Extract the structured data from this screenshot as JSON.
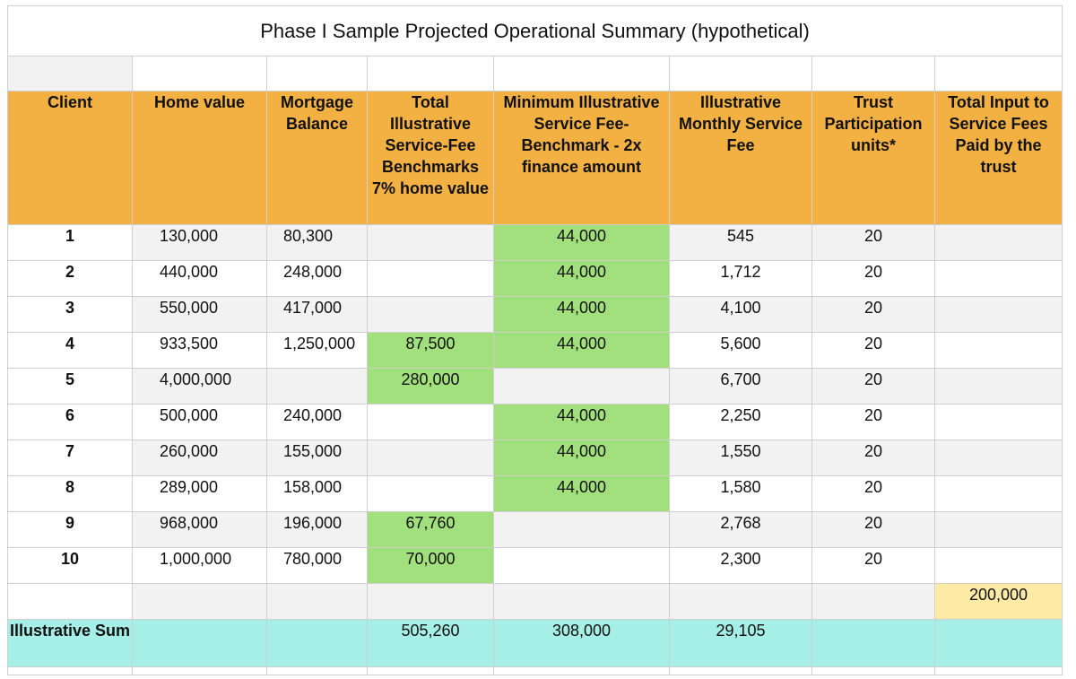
{
  "title": "Phase I Sample Projected Operational Summary (hypothetical)",
  "headers": [
    "Client",
    "Home value",
    "Mortgage Balance",
    "Total Illustrative Service-Fee Benchmarks 7% home value",
    "Minimum Illustrative Service Fee- Benchmark - 2x finance amount",
    "Illustrative Monthly Service Fee",
    "Trust Participation units*",
    "Total Input to Service Fees Paid by the trust"
  ],
  "rows": [
    {
      "client": "1",
      "home_value": "130,000",
      "mortgage": "80,300",
      "seven_pct": "",
      "min_fee": "44,000",
      "monthly": "545",
      "units": "20",
      "total_input": ""
    },
    {
      "client": "2",
      "home_value": "440,000",
      "mortgage": "248,000",
      "seven_pct": "",
      "min_fee": "44,000",
      "monthly": "1,712",
      "units": "20",
      "total_input": ""
    },
    {
      "client": "3",
      "home_value": "550,000",
      "mortgage": "417,000",
      "seven_pct": "",
      "min_fee": "44,000",
      "monthly": "4,100",
      "units": "20",
      "total_input": ""
    },
    {
      "client": "4",
      "home_value": "933,500",
      "mortgage": "1,250,000",
      "seven_pct": "87,500",
      "min_fee": "44,000",
      "monthly": "5,600",
      "units": "20",
      "total_input": ""
    },
    {
      "client": "5",
      "home_value": "4,000,000",
      "mortgage": "",
      "seven_pct": "280,000",
      "min_fee": "",
      "monthly": "6,700",
      "units": "20",
      "total_input": ""
    },
    {
      "client": "6",
      "home_value": "500,000",
      "mortgage": "240,000",
      "seven_pct": "",
      "min_fee": "44,000",
      "monthly": "2,250",
      "units": "20",
      "total_input": ""
    },
    {
      "client": "7",
      "home_value": "260,000",
      "mortgage": "155,000",
      "seven_pct": "",
      "min_fee": "44,000",
      "monthly": "1,550",
      "units": "20",
      "total_input": ""
    },
    {
      "client": "8",
      "home_value": "289,000",
      "mortgage": "158,000",
      "seven_pct": "",
      "min_fee": "44,000",
      "monthly": "1,580",
      "units": "20",
      "total_input": ""
    },
    {
      "client": "9",
      "home_value": "968,000",
      "mortgage": "196,000",
      "seven_pct": "67,760",
      "min_fee": "",
      "monthly": "2,768",
      "units": "20",
      "total_input": ""
    },
    {
      "client": "10",
      "home_value": "1,000,000",
      "mortgage": "780,000",
      "seven_pct": "70,000",
      "min_fee": "",
      "monthly": "2,300",
      "units": "20",
      "total_input": ""
    }
  ],
  "trust_total": "200,000",
  "sum_row": {
    "label": "Illustrative Sum",
    "seven_pct": "505,260",
    "min_fee": "308,000",
    "monthly": "29,105"
  },
  "colors": {
    "header": "#f2b142",
    "highlight_green": "#a2e07e",
    "highlight_yellow": "#fdeba5",
    "sum_teal": "#a6efe6",
    "alt_row_grey": "#f2f2f2",
    "grid_line": "#cfcfcf"
  }
}
